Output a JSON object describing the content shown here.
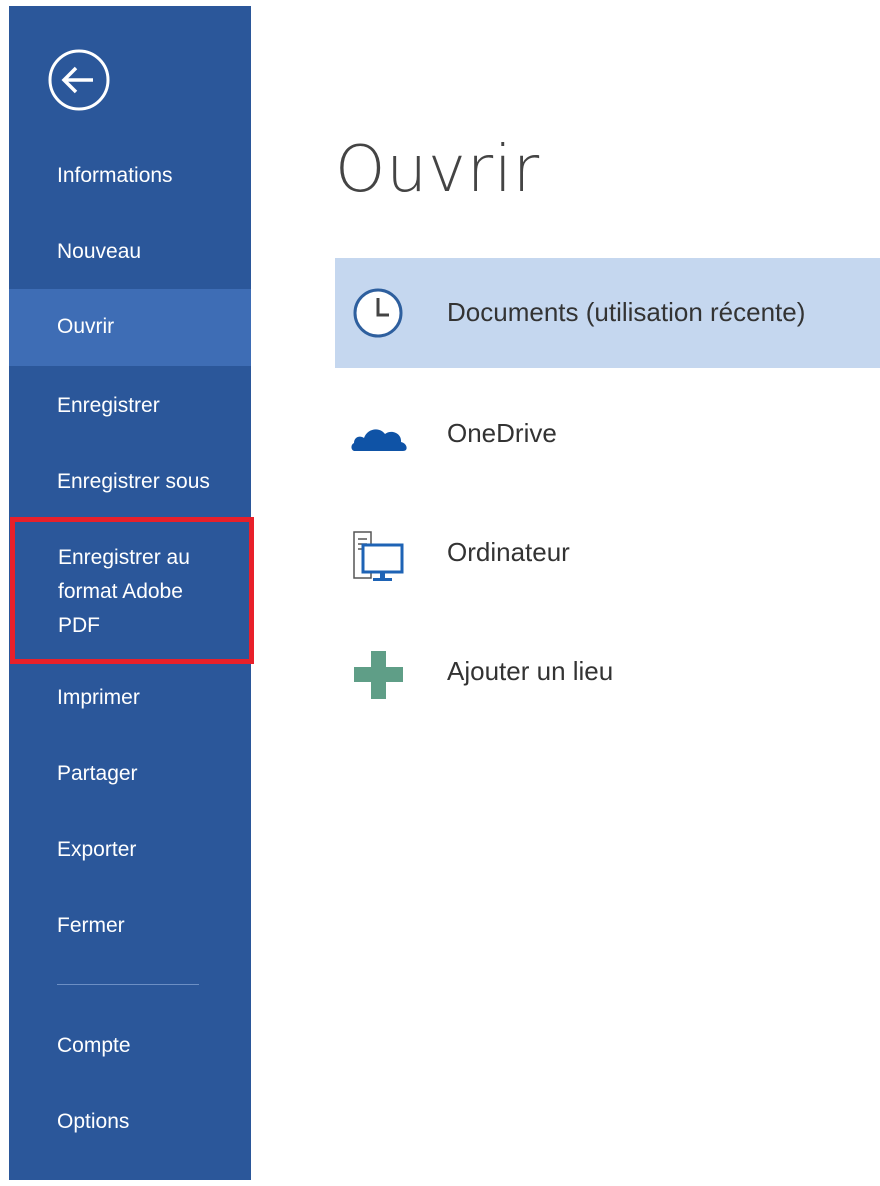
{
  "sidebar": {
    "items": [
      {
        "label": "Informations"
      },
      {
        "label": "Nouveau"
      },
      {
        "label": "Ouvrir"
      },
      {
        "label": "Enregistrer"
      },
      {
        "label": "Enregistrer sous"
      },
      {
        "label": "Enregistrer au format Adobe PDF",
        "lines": [
          "Enregistrer au",
          "format Adobe",
          "PDF"
        ]
      },
      {
        "label": "Imprimer"
      },
      {
        "label": "Partager"
      },
      {
        "label": "Exporter"
      },
      {
        "label": "Fermer"
      },
      {
        "label": "Compte"
      },
      {
        "label": "Options"
      }
    ],
    "selected": "Ouvrir",
    "highlighted": "Enregistrer au format Adobe PDF"
  },
  "main": {
    "title": "Ouvrir",
    "locations": [
      {
        "label": "Documents (utilisation récente)",
        "icon": "clock-icon",
        "selected": true
      },
      {
        "label": "OneDrive",
        "icon": "cloud-icon"
      },
      {
        "label": "Ordinateur",
        "icon": "computer-icon"
      },
      {
        "label": "Ajouter un lieu",
        "icon": "plus-icon"
      }
    ]
  },
  "colors": {
    "sidebar": "#2b579a",
    "sidebar_selected": "#3e6db5",
    "highlight_border": "#e8202a",
    "location_selected": "#c5d7ef"
  }
}
